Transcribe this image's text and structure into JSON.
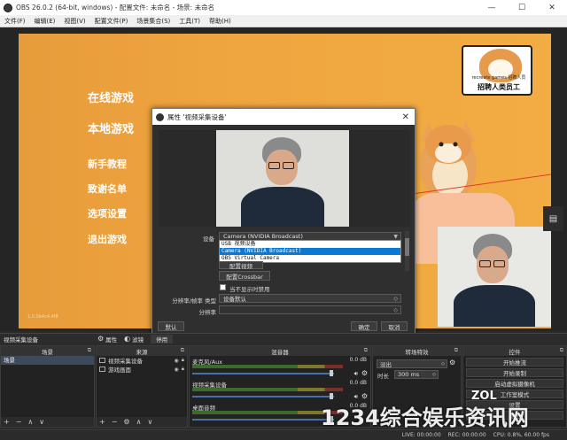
{
  "window": {
    "title": "OBS 26.0.2 (64-bit, windows) - 配置文件: 未命名 - 场景: 未命名",
    "minimize": "—",
    "maximize": "☐",
    "close": "✕"
  },
  "menubar": [
    "文件(F)",
    "编辑(E)",
    "视图(V)",
    "配置文件(P)",
    "场景集合(S)",
    "工具(T)",
    "帮助(H)"
  ],
  "preview": {
    "menu_items": [
      "在线游戏",
      "本地游戏",
      "新手教程",
      "致谢名单",
      "选项设置",
      "退出游戏"
    ],
    "badge_caption_small": "recreate games 招聘人员",
    "badge_caption": "招聘人类员工",
    "version": "1.0.0b4c4.4f8",
    "side_btn": "▤"
  },
  "dialog": {
    "title": "属性 '视频采集设备'",
    "close": "✕",
    "device_label": "设备",
    "device_value": "Camera (NVIDIA Broadcast)",
    "dropdown_options": [
      "USB 视频设备",
      "Camera (NVIDIA Broadcast)",
      "OBS Virtual Camera"
    ],
    "configure_video_btn": "配置视频",
    "configure_crossbar_btn": "配置Crossbar",
    "deactivate_label": "当不显示时禁用",
    "res_type_label": "分辨率/帧率 类型",
    "res_type_value": "设备默认",
    "resolution_label": "分辨率",
    "defaults_btn": "默认",
    "ok_btn": "确定",
    "cancel_btn": "取消"
  },
  "sourcebar": {
    "selected_source": "视频采集设备",
    "properties": "属性",
    "filters": "滤镜",
    "deactivate": "停用"
  },
  "scenes": {
    "title": "场景",
    "items": [
      "场景"
    ],
    "footer": [
      "+",
      "−",
      "∧",
      "∨"
    ]
  },
  "sources": {
    "title": "来源",
    "items": [
      "视频采集设备",
      "游戏画面"
    ],
    "footer": [
      "+",
      "−",
      "⚙",
      "∧",
      "∨"
    ]
  },
  "mixer": {
    "title": "混音器",
    "channels": [
      {
        "name": "麦克风/Aux",
        "db": "0.0 dB"
      },
      {
        "name": "视频采集设备",
        "db": "0.0 dB"
      },
      {
        "name": "桌面音频",
        "db": "0.0 dB"
      }
    ]
  },
  "transitions": {
    "title": "转场特效",
    "type": "淡出",
    "duration_label": "时长",
    "duration": "300 ms",
    "footer": [
      "+",
      "−",
      "⚙"
    ]
  },
  "controls": {
    "title": "控件",
    "buttons": [
      "开始推流",
      "开始录制",
      "启动虚拟摄像机",
      "工作室模式",
      "设置",
      "退出"
    ]
  },
  "status": {
    "live": "LIVE: 00:00:00",
    "rec": "REC: 00:00:00",
    "cpu": "CPU: 0.8%, 60.00 fps"
  },
  "watermark": {
    "text": "1234综合娱乐资讯网",
    "zol": "ZOL"
  }
}
